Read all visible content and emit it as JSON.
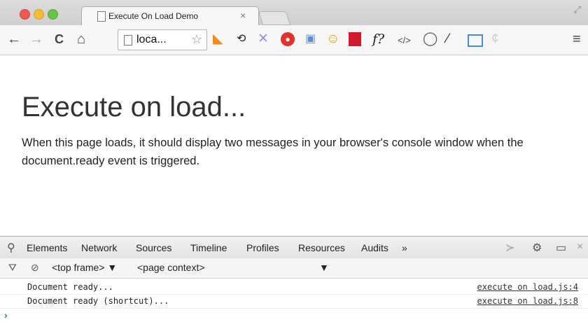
{
  "tab": {
    "title": "Execute On Load Demo",
    "close": "×"
  },
  "toolbar": {
    "back": "←",
    "forward": "→",
    "reload": "C",
    "home": "⌂",
    "url": "loca...",
    "star": "☆",
    "extensions": [
      "rss-icon",
      "sync-icon",
      "x-icon",
      "stop-icon",
      "window-icon",
      "face-icon",
      "red-book-icon",
      "f?",
      "</>",
      "circle-icon",
      "dropper-icon",
      "screen-lock-icon",
      "c-icon"
    ],
    "menu": "≡"
  },
  "page": {
    "heading": "Execute on load...",
    "paragraph": "When this page loads, it should display two messages in your browser's console window when the document.ready event is triggered."
  },
  "devtools": {
    "tabs": [
      "Elements",
      "Network",
      "Sources",
      "Timeline",
      "Profiles",
      "Resources",
      "Audits"
    ],
    "more": "»",
    "frame_select": "<top frame> ▼",
    "context_select": "<page context>",
    "context_arrow": "▼",
    "logs": [
      {
        "message": "Document ready...",
        "source": "execute on load.js:4"
      },
      {
        "message": "Document ready (shortcut)...",
        "source": "execute on load.js:8"
      }
    ],
    "prompt": "›"
  }
}
